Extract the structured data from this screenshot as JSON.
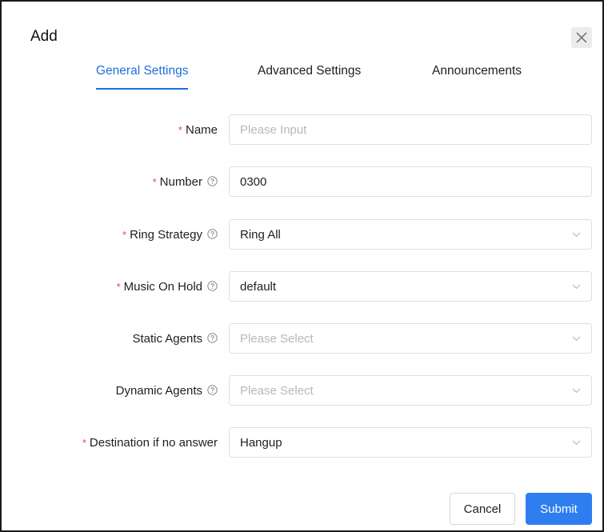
{
  "dialog": {
    "title": "Add",
    "close_icon": "close-icon"
  },
  "tabs": [
    {
      "label": "General Settings",
      "active": true
    },
    {
      "label": "Advanced Settings",
      "active": false
    },
    {
      "label": "Announcements",
      "active": false
    }
  ],
  "form": {
    "name": {
      "label": "Name",
      "required": true,
      "help": false,
      "value": "",
      "placeholder": "Please Input"
    },
    "number": {
      "label": "Number",
      "required": true,
      "help": true,
      "value": "0300"
    },
    "ring_strategy": {
      "label": "Ring Strategy",
      "required": true,
      "help": true,
      "value": "Ring All"
    },
    "music_on_hold": {
      "label": "Music On Hold",
      "required": true,
      "help": true,
      "value": "default"
    },
    "static_agents": {
      "label": "Static Agents",
      "required": false,
      "help": true,
      "placeholder": "Please Select"
    },
    "dynamic_agents": {
      "label": "Dynamic Agents",
      "required": false,
      "help": true,
      "placeholder": "Please Select"
    },
    "destination": {
      "label": "Destination if no answer",
      "required": true,
      "help": false,
      "value": "Hangup"
    }
  },
  "required_mark": "*",
  "buttons": {
    "cancel": "Cancel",
    "submit": "Submit"
  },
  "colors": {
    "accent": "#1f6fdb",
    "primary_button": "#2f7ef0",
    "required": "#e5484d",
    "placeholder": "#b8b8b8"
  }
}
